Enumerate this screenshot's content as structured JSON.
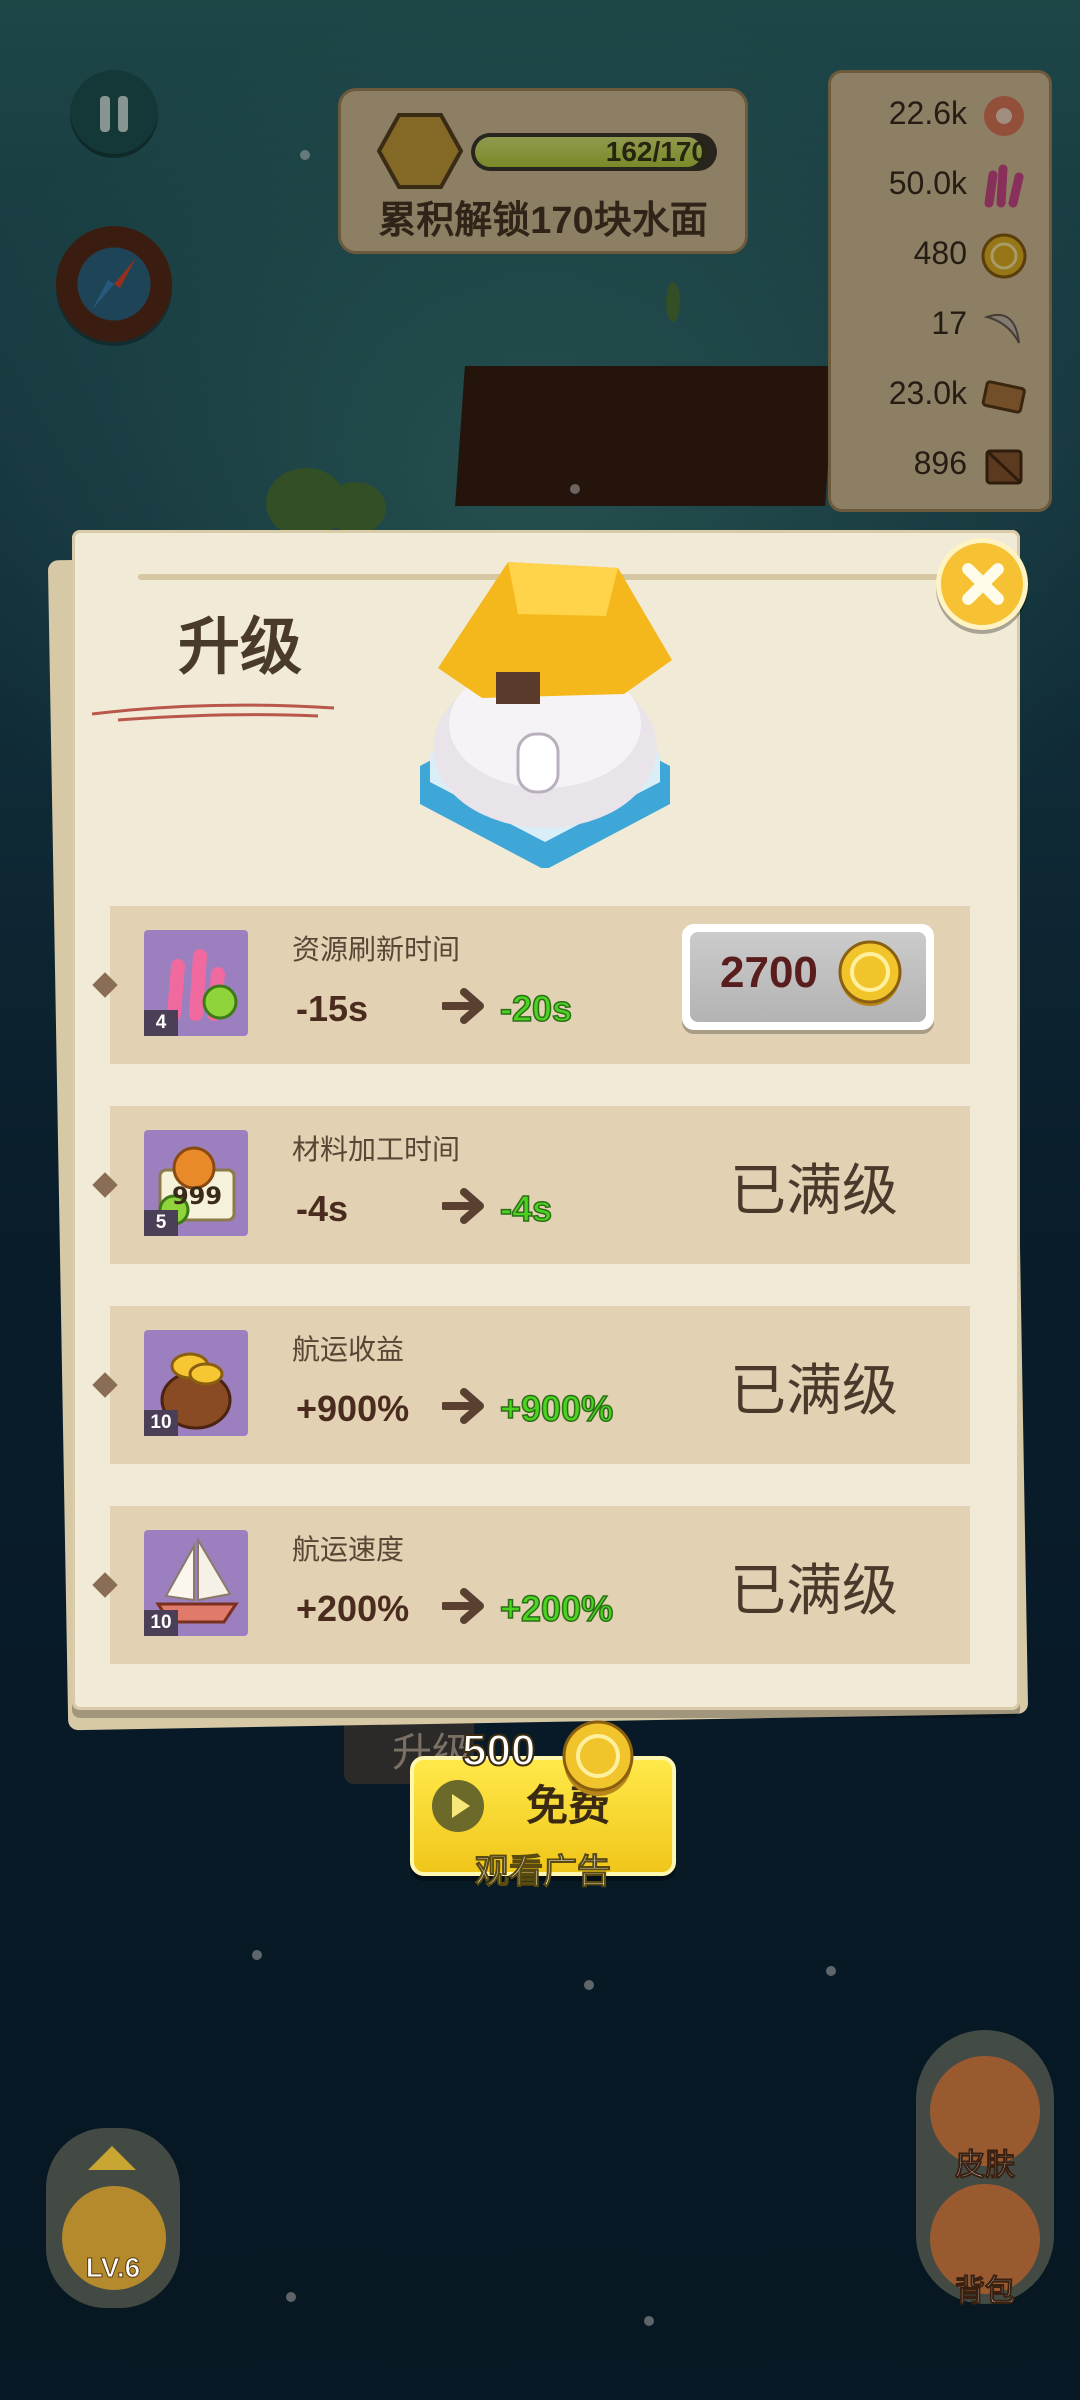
{
  "hud": {
    "progress": {
      "current": 162,
      "total": 170,
      "text": "162/170",
      "fraction": 0.953,
      "label": "累积解锁170块水面"
    },
    "resources": [
      {
        "value": "22.6k",
        "icon": "meat-icon"
      },
      {
        "value": "50.0k",
        "icon": "coral-icon"
      },
      {
        "value": "480",
        "icon": "coin-icon"
      },
      {
        "value": "17",
        "icon": "horn-icon"
      },
      {
        "value": "23.0k",
        "icon": "plank-icon"
      },
      {
        "value": "896",
        "icon": "crate-icon"
      }
    ]
  },
  "modal": {
    "title": "升级",
    "close_icon": "close-icon",
    "rows": [
      {
        "name": "资源刷新时间",
        "level": "4",
        "current": "-15s",
        "next": "-20s",
        "icon": "coral-refresh-icon",
        "cost": "2700",
        "status": ""
      },
      {
        "name": "材料加工时间",
        "level": "5",
        "current": "-4s",
        "next": "-4s",
        "icon": "processing-icon",
        "badge": "999",
        "status": "已满级"
      },
      {
        "name": "航运收益",
        "level": "10",
        "current": "+900%",
        "next": "+900%",
        "icon": "gold-bag-icon",
        "status": "已满级"
      },
      {
        "name": "航运速度",
        "level": "10",
        "current": "+200%",
        "next": "+200%",
        "icon": "sailboat-icon",
        "status": "已满级"
      }
    ]
  },
  "bottom": {
    "upgrade_label": "升级",
    "ad": {
      "amount": "500",
      "free_label": "免费",
      "sub_label": "观看广告"
    },
    "level": {
      "label": "LV.6"
    },
    "skin": {
      "label": "皮肤"
    },
    "bag": {
      "label": "背包"
    }
  },
  "colors": {
    "panel": "#f1ead6",
    "row": "#e2d1b2",
    "accent_green": "#4bd321",
    "gold": "#f6c233"
  }
}
